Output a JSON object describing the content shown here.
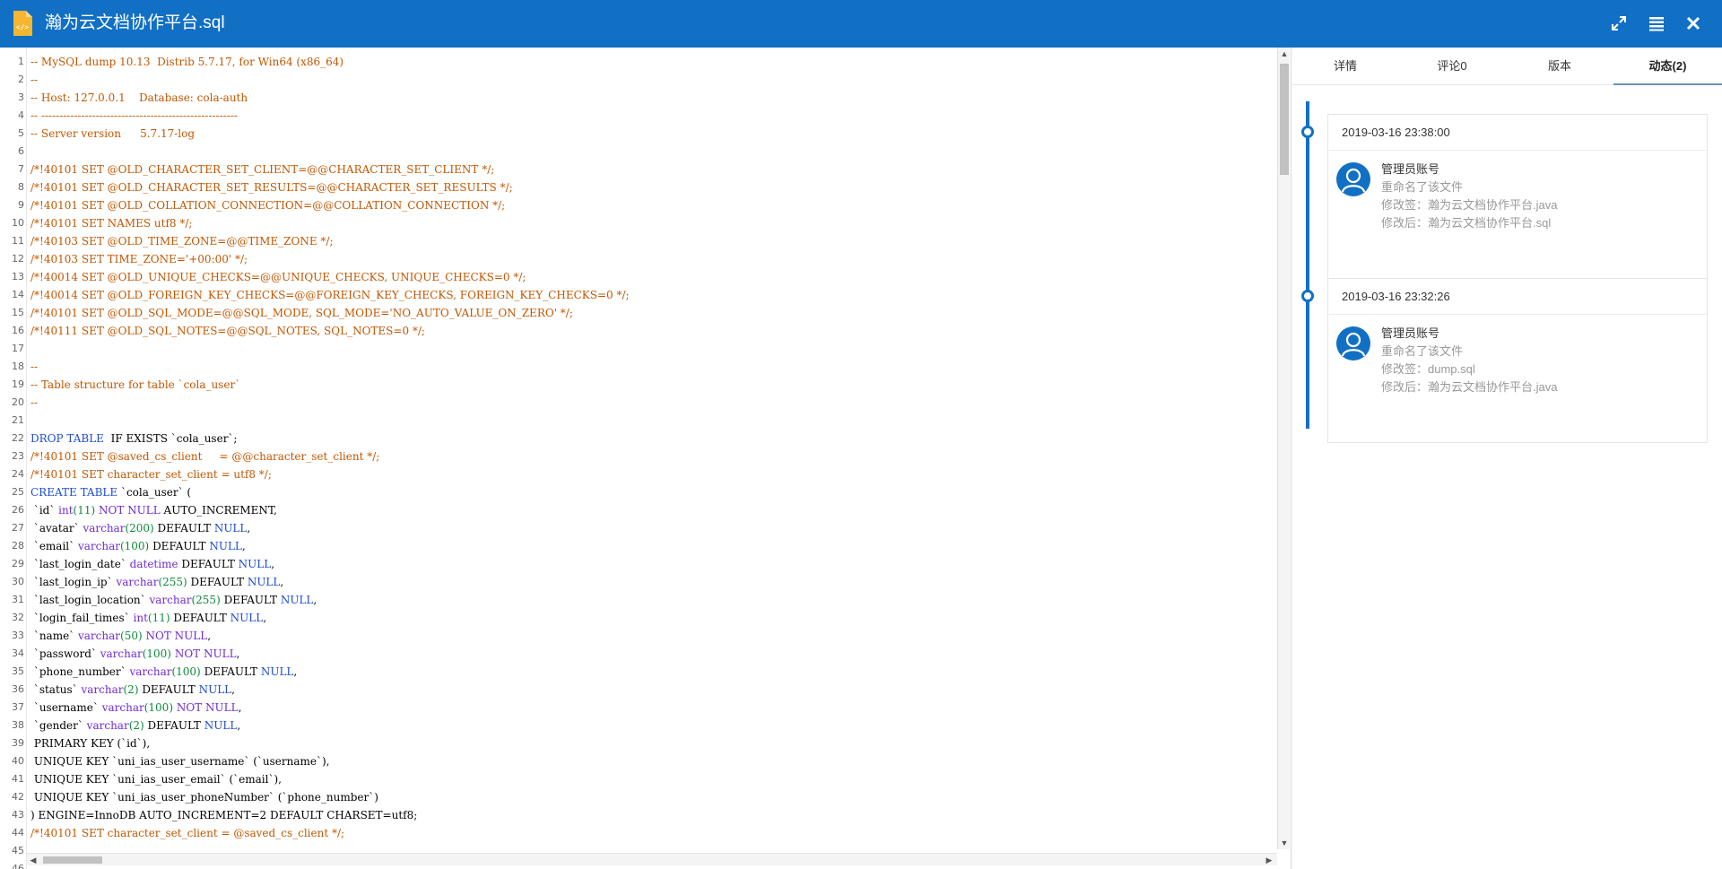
{
  "header": {
    "title": "瀚为云文档协作平台.sql",
    "icons": [
      "file-code-icon",
      "fullscreen-icon",
      "list-icon",
      "close-icon"
    ]
  },
  "editor": {
    "lines": [
      [
        [
          "cm",
          "-- MySQL dump 10.13  Distrib 5.7.17, for Win64 (x86_64)"
        ]
      ],
      [
        [
          "cm",
          "--"
        ]
      ],
      [
        [
          "cm",
          "-- Host: 127.0.0.1    Database: cola-auth"
        ]
      ],
      [
        [
          "cm",
          "-- ------------------------------------------------------"
        ]
      ],
      [
        [
          "cm",
          "-- Server version\t5.7.17-log"
        ]
      ],
      [],
      [
        [
          "cm",
          "/*!40101 SET @OLD_CHARACTER_SET_CLIENT=@@CHARACTER_SET_CLIENT */;"
        ]
      ],
      [
        [
          "cm",
          "/*!40101 SET @OLD_CHARACTER_SET_RESULTS=@@CHARACTER_SET_RESULTS */;"
        ]
      ],
      [
        [
          "cm",
          "/*!40101 SET @OLD_COLLATION_CONNECTION=@@COLLATION_CONNECTION */;"
        ]
      ],
      [
        [
          "cm",
          "/*!40101 SET NAMES utf8 */;"
        ]
      ],
      [
        [
          "cm",
          "/*!40103 SET @OLD_TIME_ZONE=@@TIME_ZONE */;"
        ]
      ],
      [
        [
          "cm",
          "/*!40103 SET TIME_ZONE='+00:00' */;"
        ]
      ],
      [
        [
          "cm",
          "/*!40014 SET @OLD_UNIQUE_CHECKS=@@UNIQUE_CHECKS, UNIQUE_CHECKS=0 */;"
        ]
      ],
      [
        [
          "cm",
          "/*!40014 SET @OLD_FOREIGN_KEY_CHECKS=@@FOREIGN_KEY_CHECKS, FOREIGN_KEY_CHECKS=0 */;"
        ]
      ],
      [
        [
          "cm",
          "/*!40101 SET @OLD_SQL_MODE=@@SQL_MODE, SQL_MODE='NO_AUTO_VALUE_ON_ZERO' */;"
        ]
      ],
      [
        [
          "cm",
          "/*!40111 SET @OLD_SQL_NOTES=@@SQL_NOTES, SQL_NOTES=0 */;"
        ]
      ],
      [],
      [
        [
          "cm",
          "--"
        ]
      ],
      [
        [
          "cm",
          "-- Table structure for table `cola_user`"
        ]
      ],
      [
        [
          "cm",
          "--"
        ]
      ],
      [],
      [
        [
          "kw2",
          "DROP TABLE"
        ],
        [
          "",
          "  IF EXISTS `cola_user`;"
        ]
      ],
      [
        [
          "cm",
          "/*!40101 SET @saved_cs_client     = @@character_set_client */;"
        ]
      ],
      [
        [
          "cm",
          "/*!40101 SET character_set_client = utf8 */;"
        ]
      ],
      [
        [
          "kw2",
          "CREATE TABLE"
        ],
        [
          "",
          " `cola_user` ("
        ]
      ],
      [
        [
          "",
          " `id` "
        ],
        [
          "kw",
          "int"
        ],
        [
          "num",
          "(11)"
        ],
        [
          "",
          " "
        ],
        [
          "kw",
          "NOT NULL"
        ],
        [
          "",
          " AUTO_INCREMENT,"
        ]
      ],
      [
        [
          "",
          " `avatar` "
        ],
        [
          "kw",
          "varchar"
        ],
        [
          "num",
          "(200)"
        ],
        [
          "",
          " DEFAULT "
        ],
        [
          "kw2",
          "NULL"
        ],
        [
          "",
          ","
        ]
      ],
      [
        [
          "",
          " `email` "
        ],
        [
          "kw",
          "varchar"
        ],
        [
          "num",
          "(100)"
        ],
        [
          "",
          " DEFAULT "
        ],
        [
          "kw2",
          "NULL"
        ],
        [
          "",
          ","
        ]
      ],
      [
        [
          "",
          " `last_login_date` "
        ],
        [
          "kw",
          "datetime"
        ],
        [
          "",
          " DEFAULT "
        ],
        [
          "kw2",
          "NULL"
        ],
        [
          "",
          ","
        ]
      ],
      [
        [
          "",
          " `last_login_ip` "
        ],
        [
          "kw",
          "varchar"
        ],
        [
          "num",
          "(255)"
        ],
        [
          "",
          " DEFAULT "
        ],
        [
          "kw2",
          "NULL"
        ],
        [
          "",
          ","
        ]
      ],
      [
        [
          "",
          " `last_login_location` "
        ],
        [
          "kw",
          "varchar"
        ],
        [
          "num",
          "(255)"
        ],
        [
          "",
          " DEFAULT "
        ],
        [
          "kw2",
          "NULL"
        ],
        [
          "",
          ","
        ]
      ],
      [
        [
          "",
          " `login_fail_times` "
        ],
        [
          "kw",
          "int"
        ],
        [
          "num",
          "(11)"
        ],
        [
          "",
          " DEFAULT "
        ],
        [
          "kw2",
          "NULL"
        ],
        [
          "",
          ","
        ]
      ],
      [
        [
          "",
          " `name` "
        ],
        [
          "kw",
          "varchar"
        ],
        [
          "num",
          "(50)"
        ],
        [
          "",
          " "
        ],
        [
          "kw",
          "NOT NULL"
        ],
        [
          "",
          ","
        ]
      ],
      [
        [
          "",
          " `password` "
        ],
        [
          "kw",
          "varchar"
        ],
        [
          "num",
          "(100)"
        ],
        [
          "",
          " "
        ],
        [
          "kw",
          "NOT NULL"
        ],
        [
          "",
          ","
        ]
      ],
      [
        [
          "",
          " `phone_number` "
        ],
        [
          "kw",
          "varchar"
        ],
        [
          "num",
          "(100)"
        ],
        [
          "",
          " DEFAULT "
        ],
        [
          "kw2",
          "NULL"
        ],
        [
          "",
          ","
        ]
      ],
      [
        [
          "",
          " `status` "
        ],
        [
          "kw",
          "varchar"
        ],
        [
          "num",
          "(2)"
        ],
        [
          "",
          " DEFAULT "
        ],
        [
          "kw2",
          "NULL"
        ],
        [
          "",
          ","
        ]
      ],
      [
        [
          "",
          " `username` "
        ],
        [
          "kw",
          "varchar"
        ],
        [
          "num",
          "(100)"
        ],
        [
          "",
          " "
        ],
        [
          "kw",
          "NOT NULL"
        ],
        [
          "",
          ","
        ]
      ],
      [
        [
          "",
          " `gender` "
        ],
        [
          "kw",
          "varchar"
        ],
        [
          "num",
          "(2)"
        ],
        [
          "",
          " DEFAULT "
        ],
        [
          "kw2",
          "NULL"
        ],
        [
          "",
          ","
        ]
      ],
      [
        [
          "",
          " PRIMARY KEY (`id`),"
        ]
      ],
      [
        [
          "",
          " UNIQUE KEY `uni_ias_user_username` (`username`),"
        ]
      ],
      [
        [
          "",
          " UNIQUE KEY `uni_ias_user_email` (`email`),"
        ]
      ],
      [
        [
          "",
          " UNIQUE KEY `uni_ias_user_phoneNumber` (`phone_number`)"
        ]
      ],
      [
        [
          "",
          ") ENGINE=InnoDB AUTO_INCREMENT=2 DEFAULT CHARSET=utf8;"
        ]
      ],
      [
        [
          "cm",
          "/*!40101 SET character_set_client = @saved_cs_client */;"
        ]
      ],
      [],
      []
    ]
  },
  "panel": {
    "tabs": [
      {
        "label": "详情",
        "active": false
      },
      {
        "label": "评论0",
        "active": false
      },
      {
        "label": "版本",
        "active": false
      },
      {
        "label": "动态(2)",
        "active": true
      }
    ],
    "activities": [
      {
        "time": "2019-03-16 23:38:00",
        "user": "管理员账号",
        "action": "重命名了该文件",
        "before": "修改签：瀚为云文档协作平台.java",
        "after": "修改后：瀚为云文档协作平台.sql"
      },
      {
        "time": "2019-03-16 23:32:26",
        "user": "管理员账号",
        "action": "重命名了该文件",
        "before": "修改签：dump.sql",
        "after": "修改后：瀚为云文档协作平台.java"
      }
    ]
  },
  "colors": {
    "header_bg": "#1170c4",
    "comment": "#c25700",
    "keyword": "#6f2cd6",
    "keyword_null": "#1d4dd6",
    "number": "#0d8a3a",
    "timeline": "#1170c4"
  }
}
